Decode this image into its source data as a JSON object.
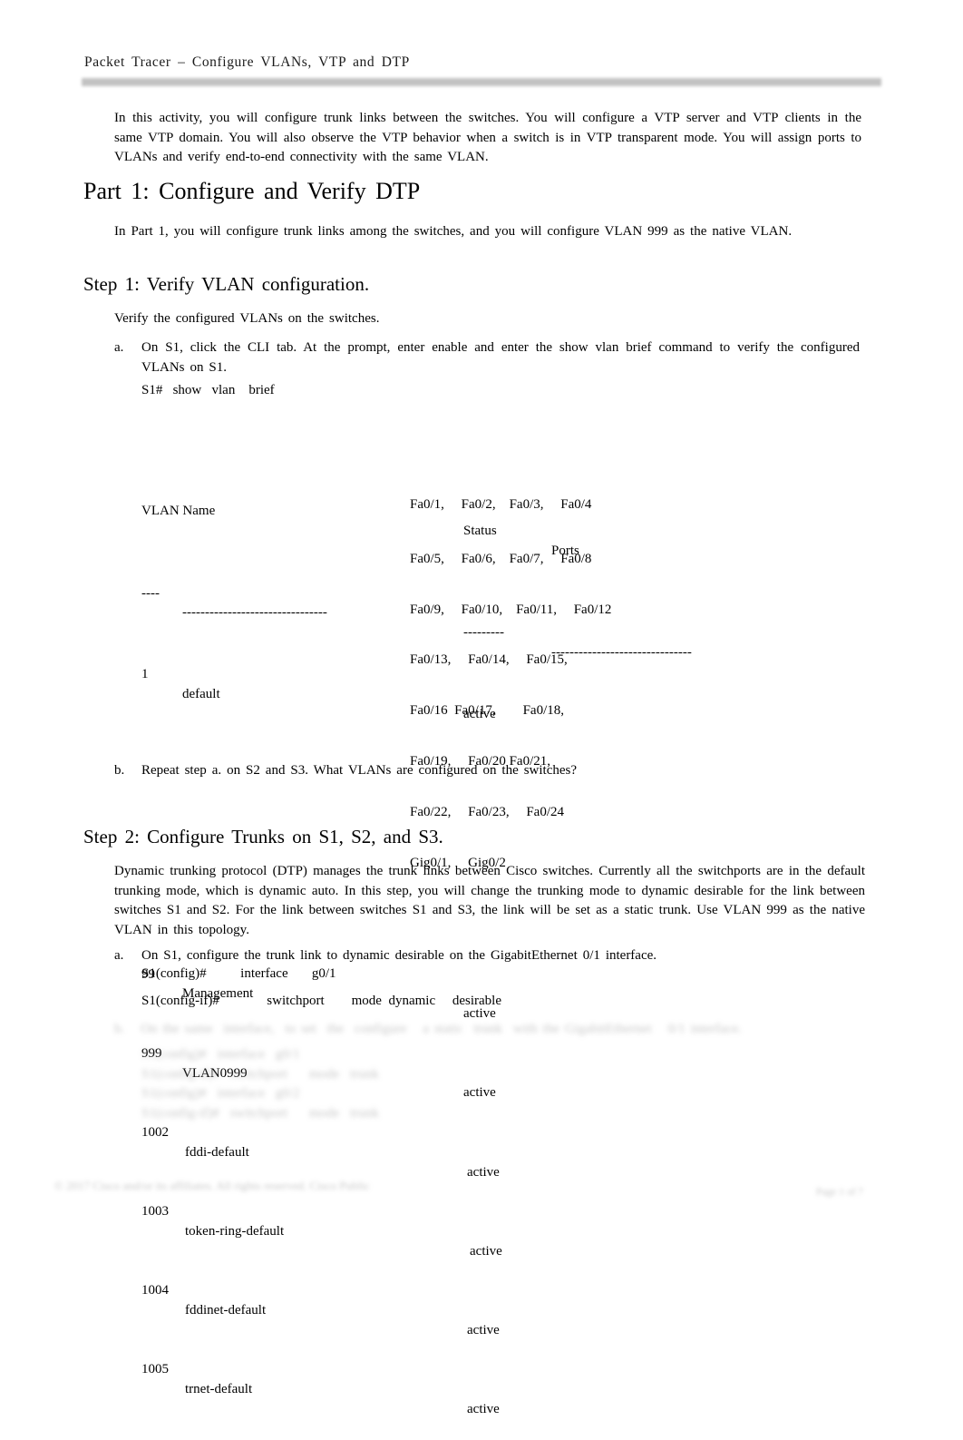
{
  "header": {
    "title": "Packet   Tracer   – Configure    VLANs,  VTP and  DTP"
  },
  "intro": {
    "paragraph": "In this  activity,  you  will configure   trunk  links  between   the  switches.   You  will configure   a  VTP server   and  VTP clients  in the  same   VTP  domain.   You  will also  observe   the  VTP behavior   when  a  switch  is in VTP  transparent mode.  You  will assign    ports  to VLANs  and  verify end-to-end     connectivity   with  the  same   VLAN."
  },
  "part1": {
    "heading": "Part  1: Configure    and  Verify  DTP",
    "body": "In Part  1, you will configure   trunk  links among   the  switches,   and  you  will configure   VLAN 999  as  the  native VLAN."
  },
  "step1": {
    "heading": "Step  1: Verify  VLAN configuration.",
    "body": "Verify the  configured   VLANs on  the  switches.",
    "item_a": {
      "marker": "a.",
      "text": "On  S1,  click the  CLI tab. At the  prompt,  enter  enable   and  enter  the  show  vlan  brief command   to verify the configured   VLANs on  S1."
    },
    "cli_prompt": "S1#   show   vlan    brief",
    "item_b": {
      "marker": "b.",
      "text": "Repeat   step  a. on  S2 and  S3. What  VLANs are   configured   on  the  switches?"
    }
  },
  "vlan_table": {
    "columns": [
      "VLAN Name",
      "Status",
      "Ports"
    ],
    "header": {
      "id_name": "VLAN Name",
      "status": "Status",
      "ports": "Ports"
    },
    "dashes": {
      "id": "----",
      "name": "--------------------------------",
      "status": "---------",
      "ports": "-------------------------------"
    },
    "rows": [
      {
        "id": "1",
        "name": "default",
        "status": "active",
        "ports": [
          "Fa0/1,     Fa0/2,    Fa0/3,     Fa0/4",
          "Fa0/5,     Fa0/6,    Fa0/7,     Fa0/8",
          "Fa0/9,     Fa0/10,    Fa0/11,     Fa0/12",
          "Fa0/13,     Fa0/14,     Fa0/15,",
          "Fa0/16  Fa0/17,        Fa0/18,",
          "Fa0/19,     Fa0/20 Fa0/21,",
          "Fa0/22,     Fa0/23,     Fa0/24",
          "Gig0/1,     Gig0/2"
        ]
      },
      {
        "id": "99",
        "name": "Management",
        "status": "active",
        "ports": []
      },
      {
        "id": "999",
        "name": "VLAN0999",
        "status": "active",
        "ports": []
      },
      {
        "id": "1002",
        "name": "fddi-default",
        "status": "active",
        "ports": []
      },
      {
        "id": "1003",
        "name": "token-ring-default",
        "status": "active",
        "ports": []
      },
      {
        "id": "1004",
        "name": "fddinet-default",
        "status": "active",
        "ports": []
      },
      {
        "id": "1005",
        "name": "trnet-default",
        "status": "active",
        "ports": []
      }
    ]
  },
  "step2": {
    "heading": "Step  2: Configure   Trunks   on  S1, S2, and  S3.",
    "body": "Dynamic  trunking  protocol  (DTP)  manages    the  trunk  links between   Cisco  switches.   Currently  all the switchports   are  in the  default  trunking   mode,  which  is dynamic   auto.  In this step,  you  will change   the trunking mode to dynamic   desirable    for the  link between   switches   S1  and  S2. For the  link between   switches   S1  and S3, the  link will be  set  as  a  static  trunk.  Use  VLAN 999  as  the  native  VLAN in this topology.",
    "item_a": {
      "marker": "a.",
      "text": "On  S1,  configure   the  trunk  link to dynamic   desirable    on  the  GigabitEthernet    0/1  interface."
    },
    "cli_interface": "S1(config)#          interface       g0/1",
    "cli_switchport": "S1(config-if)#              switchport        mode  dynamic     desirable",
    "item_b_faded": "b.   On the same  interface,  to set  the  configure   a static  trunk  with the GigabitEthernet   0/1 interface.",
    "cli_faded": "S1(config)#  interface  g0/1\nS1(config-if)#  switchport    mode  trunk\nS1(config)#  interface  g0/2\nS1(config-if)#  switchport    mode  trunk"
  },
  "footer": {
    "left": "© 2017 Cisco and/or its affiliates. All rights reserved. Cisco Public",
    "right": "Page 1 of 7"
  }
}
